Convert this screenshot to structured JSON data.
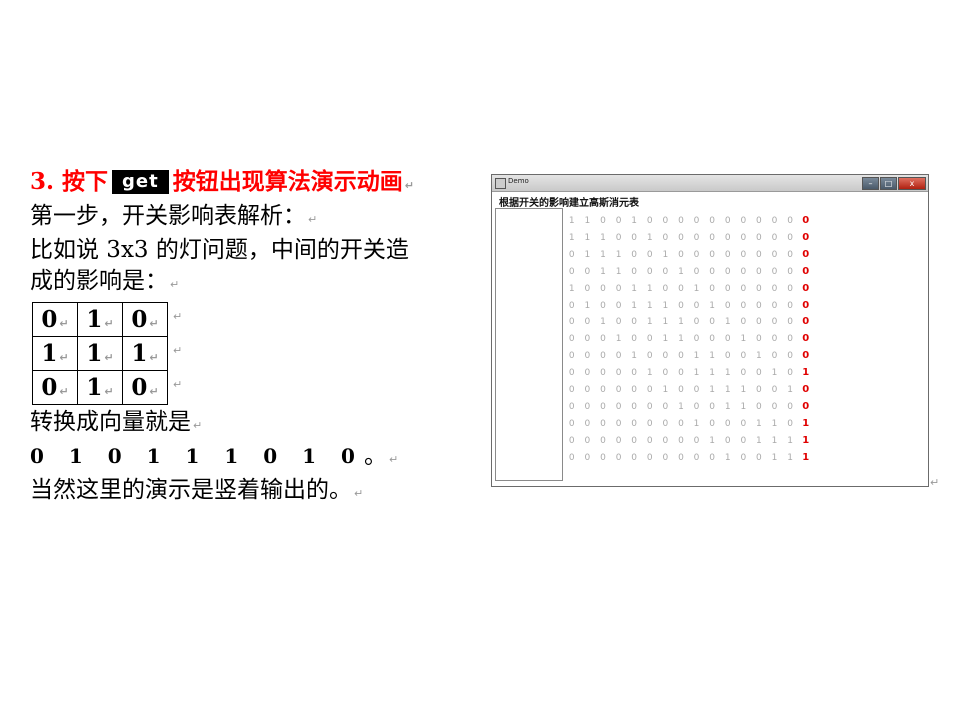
{
  "left": {
    "heading": {
      "number": "3.",
      "pre": "按下",
      "button_label": "get",
      "post": "按钮出现算法演示动画"
    },
    "lines": [
      "第一步，开关影响表解析：",
      "比如说 3x3 的灯问题，中间的开关造",
      "成的影响是："
    ],
    "grid": [
      [
        "0",
        "1",
        "0"
      ],
      [
        "1",
        "1",
        "1"
      ],
      [
        "0",
        "1",
        "0"
      ]
    ],
    "after_grid": "转换成向量就是",
    "vector": "0 1 0 1 1 1 0 1 0",
    "vector_end": "。",
    "last_line": "当然这里的演示是竖着输出的。",
    "mark": "↵"
  },
  "window": {
    "title": "Demo",
    "caption": "根据开关的影响建立高斯消元表",
    "controls": {
      "minimize": "–",
      "maximize": "□",
      "close": "x"
    },
    "accent_color": "#e00000",
    "rows": [
      [
        "1",
        "1",
        "0",
        "0",
        "1",
        "0",
        "0",
        "0",
        "0",
        "0",
        "0",
        "0",
        "0",
        "0",
        "0",
        "0"
      ],
      [
        "1",
        "1",
        "1",
        "0",
        "0",
        "1",
        "0",
        "0",
        "0",
        "0",
        "0",
        "0",
        "0",
        "0",
        "0",
        "0"
      ],
      [
        "0",
        "1",
        "1",
        "1",
        "0",
        "0",
        "1",
        "0",
        "0",
        "0",
        "0",
        "0",
        "0",
        "0",
        "0",
        "0"
      ],
      [
        "0",
        "0",
        "1",
        "1",
        "0",
        "0",
        "0",
        "1",
        "0",
        "0",
        "0",
        "0",
        "0",
        "0",
        "0",
        "0"
      ],
      [
        "1",
        "0",
        "0",
        "0",
        "1",
        "1",
        "0",
        "0",
        "1",
        "0",
        "0",
        "0",
        "0",
        "0",
        "0",
        "0"
      ],
      [
        "0",
        "1",
        "0",
        "0",
        "1",
        "1",
        "1",
        "0",
        "0",
        "1",
        "0",
        "0",
        "0",
        "0",
        "0",
        "0"
      ],
      [
        "0",
        "0",
        "1",
        "0",
        "0",
        "1",
        "1",
        "1",
        "0",
        "0",
        "1",
        "0",
        "0",
        "0",
        "0",
        "0"
      ],
      [
        "0",
        "0",
        "0",
        "1",
        "0",
        "0",
        "1",
        "1",
        "0",
        "0",
        "0",
        "1",
        "0",
        "0",
        "0",
        "0"
      ],
      [
        "0",
        "0",
        "0",
        "0",
        "1",
        "0",
        "0",
        "0",
        "1",
        "1",
        "0",
        "0",
        "1",
        "0",
        "0",
        "0"
      ],
      [
        "0",
        "0",
        "0",
        "0",
        "0",
        "1",
        "0",
        "0",
        "1",
        "1",
        "1",
        "0",
        "0",
        "1",
        "0",
        "1"
      ],
      [
        "0",
        "0",
        "0",
        "0",
        "0",
        "0",
        "1",
        "0",
        "0",
        "1",
        "1",
        "1",
        "0",
        "0",
        "1",
        "0"
      ],
      [
        "0",
        "0",
        "0",
        "0",
        "0",
        "0",
        "0",
        "1",
        "0",
        "0",
        "1",
        "1",
        "0",
        "0",
        "0",
        "0"
      ],
      [
        "0",
        "0",
        "0",
        "0",
        "0",
        "0",
        "0",
        "0",
        "1",
        "0",
        "0",
        "0",
        "1",
        "1",
        "0",
        "1"
      ],
      [
        "0",
        "0",
        "0",
        "0",
        "0",
        "0",
        "0",
        "0",
        "0",
        "1",
        "0",
        "0",
        "1",
        "1",
        "1",
        "1"
      ],
      [
        "0",
        "0",
        "0",
        "0",
        "0",
        "0",
        "0",
        "0",
        "0",
        "0",
        "1",
        "0",
        "0",
        "1",
        "1",
        "1"
      ]
    ]
  }
}
